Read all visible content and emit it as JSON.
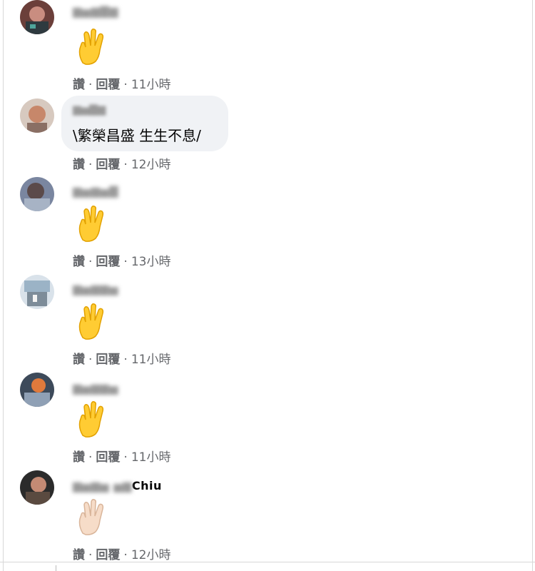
{
  "actions": {
    "like": "讚",
    "reply": "回覆",
    "separator": "·"
  },
  "colors": {
    "bubble": "#f0f2f5",
    "action_text": "#65676b",
    "hand_yellow": "#ffcc33",
    "hand_light": "#f6dcc8"
  },
  "comments": [
    {
      "name": "",
      "text": "",
      "emoji": "vulcan-salute-yellow",
      "time": "11小時"
    },
    {
      "name": "",
      "text": "\\繁榮昌盛 生生不息/",
      "emoji": "",
      "time": "12小時"
    },
    {
      "name": "",
      "text": "",
      "emoji": "vulcan-salute-yellow",
      "time": "13小時"
    },
    {
      "name": "",
      "text": "",
      "emoji": "vulcan-salute-yellow",
      "time": "11小時"
    },
    {
      "name": "",
      "text": "",
      "emoji": "vulcan-salute-yellow",
      "time": "11小時"
    },
    {
      "name": "Chiu",
      "text": "",
      "emoji": "vulcan-salute-light",
      "time": "12小時"
    }
  ]
}
